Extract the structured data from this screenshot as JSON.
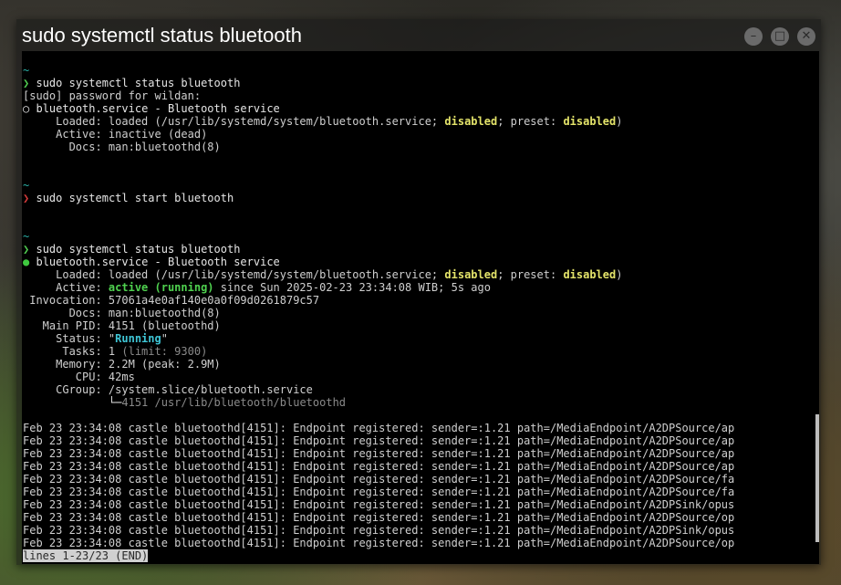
{
  "window": {
    "title": "sudo systemctl status bluetooth",
    "controls": {
      "minimize": "–",
      "maximize": "□",
      "close": "✕"
    }
  },
  "terminal": {
    "prompt_tilde": "~",
    "prompt_arrow": "❯",
    "cmd1": "sudo systemctl status bluetooth",
    "sudo_prompt": "[sudo] password for wildan:",
    "s1": {
      "dot": "○",
      "unit": "bluetooth.service - Bluetooth service",
      "loaded_label": "     Loaded: ",
      "loaded_pre": "loaded (/usr/lib/systemd/system/bluetooth.service; ",
      "disabled1": "disabled",
      "loaded_mid": "; preset: ",
      "disabled2": "disabled",
      "loaded_end": ")",
      "active_label": "     Active: ",
      "active_value": "inactive (dead)",
      "docs_label": "       Docs: ",
      "docs_value": "man:bluetoothd(8)"
    },
    "cmd2": "sudo systemctl start bluetooth",
    "cmd3": "sudo systemctl status bluetooth",
    "s2": {
      "dot": "●",
      "unit": "bluetooth.service - Bluetooth service",
      "loaded_label": "     Loaded: ",
      "loaded_pre": "loaded (/usr/lib/systemd/system/bluetooth.service; ",
      "disabled1": "disabled",
      "loaded_mid": "; preset: ",
      "disabled2": "disabled",
      "loaded_end": ")",
      "active_label": "     Active: ",
      "active_value": "active (running)",
      "active_rest": " since Sun 2025-02-23 23:34:08 WIB; 5s ago",
      "invocation_label": " Invocation: ",
      "invocation_value": "57061a4e0af140e0a0f09d0261879c57",
      "docs_label": "       Docs: ",
      "docs_value": "man:bluetoothd(8)",
      "mainpid_label": "   Main PID: ",
      "mainpid_value": "4151 (bluetoothd)",
      "status_label": "     Status: ",
      "status_q1": "\"",
      "status_value": "Running",
      "status_q2": "\"",
      "tasks_label": "      Tasks: ",
      "tasks_value": "1",
      "tasks_limit": " (limit: 9300)",
      "memory_label": "     Memory: ",
      "memory_value": "2.2M (peak: 2.9M)",
      "cpu_label": "        CPU: ",
      "cpu_value": "42ms",
      "cgroup_label": "     CGroup: ",
      "cgroup_value": "/system.slice/bluetooth.service",
      "tree_prefix": "             └─",
      "tree_value": "4151 /usr/lib/bluetooth/bluetoothd"
    },
    "log_lines": [
      "Feb 23 23:34:08 castle bluetoothd[4151]: Endpoint registered: sender=:1.21 path=/MediaEndpoint/A2DPSource/ap",
      "Feb 23 23:34:08 castle bluetoothd[4151]: Endpoint registered: sender=:1.21 path=/MediaEndpoint/A2DPSource/ap",
      "Feb 23 23:34:08 castle bluetoothd[4151]: Endpoint registered: sender=:1.21 path=/MediaEndpoint/A2DPSource/ap",
      "Feb 23 23:34:08 castle bluetoothd[4151]: Endpoint registered: sender=:1.21 path=/MediaEndpoint/A2DPSource/ap",
      "Feb 23 23:34:08 castle bluetoothd[4151]: Endpoint registered: sender=:1.21 path=/MediaEndpoint/A2DPSource/fa",
      "Feb 23 23:34:08 castle bluetoothd[4151]: Endpoint registered: sender=:1.21 path=/MediaEndpoint/A2DPSource/fa",
      "Feb 23 23:34:08 castle bluetoothd[4151]: Endpoint registered: sender=:1.21 path=/MediaEndpoint/A2DPSink/opus",
      "Feb 23 23:34:08 castle bluetoothd[4151]: Endpoint registered: sender=:1.21 path=/MediaEndpoint/A2DPSource/op",
      "Feb 23 23:34:08 castle bluetoothd[4151]: Endpoint registered: sender=:1.21 path=/MediaEndpoint/A2DPSink/opus",
      "Feb 23 23:34:08 castle bluetoothd[4151]: Endpoint registered: sender=:1.21 path=/MediaEndpoint/A2DPSource/op"
    ],
    "pager_status": "lines 1-23/23 (END)"
  }
}
